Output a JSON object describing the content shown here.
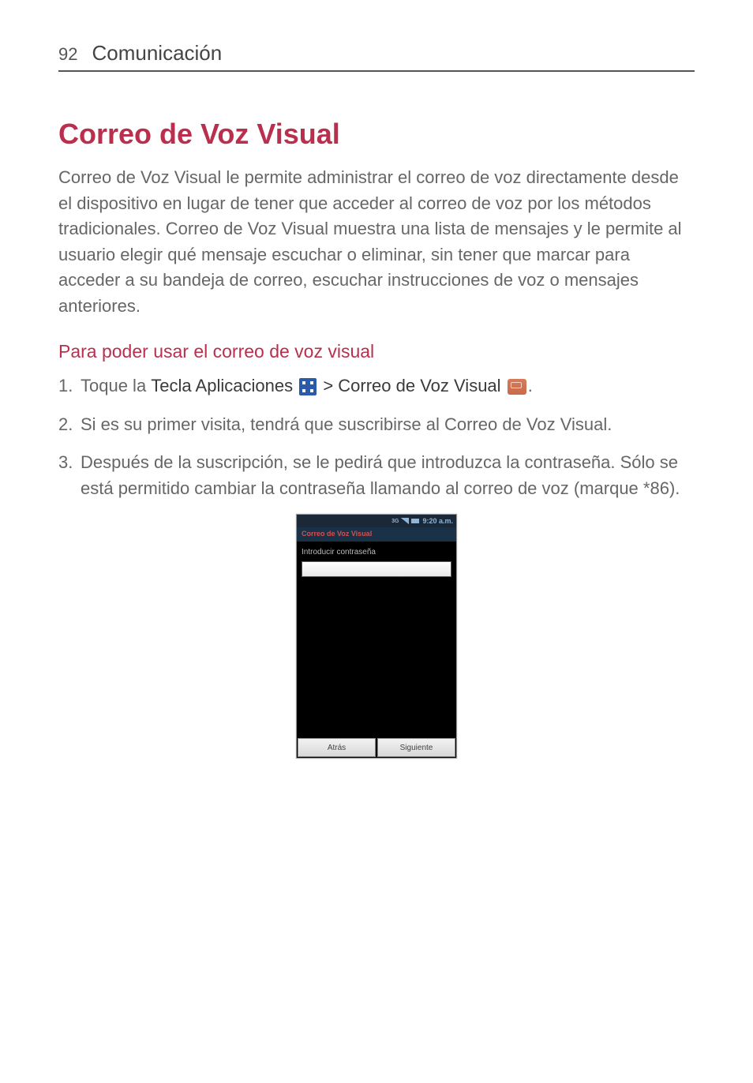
{
  "header": {
    "page_number": "92",
    "section": "Comunicación"
  },
  "title": "Correo de Voz Visual",
  "intro": "Correo de Voz Visual le permite administrar el correo de voz directamente desde el dispositivo en lugar de tener que acceder al correo de voz por los métodos tradicionales. Correo de Voz Visual muestra una lista de mensajes y le permite al usuario elegir qué mensaje escuchar o eliminar, sin tener que marcar para acceder a su bandeja de correo, escuchar instrucciones de voz o mensajes anteriores.",
  "sub_heading": "Para poder usar el correo de voz visual",
  "step1": {
    "prefix": "Toque la ",
    "apps_key": "Tecla Aplicaciones",
    "sep": " > ",
    "vvm": "Correo de Voz Visual",
    "suffix": "."
  },
  "step2": "Si es su primer visita, tendrá que suscribirse al Correo de Voz Visual.",
  "step3": "Después de la suscripción, se le pedirá que introduzca la contraseña. Sólo se está permitido cambiar la contraseña llamando al correo de voz (marque *86).",
  "screenshot": {
    "status_3g": "3G",
    "status_time": "9:20 a.m.",
    "app_title": "Correo de Voz Visual",
    "prompt": "Introducir contraseña",
    "btn_back": "Atrás",
    "btn_next": "Siguiente"
  }
}
